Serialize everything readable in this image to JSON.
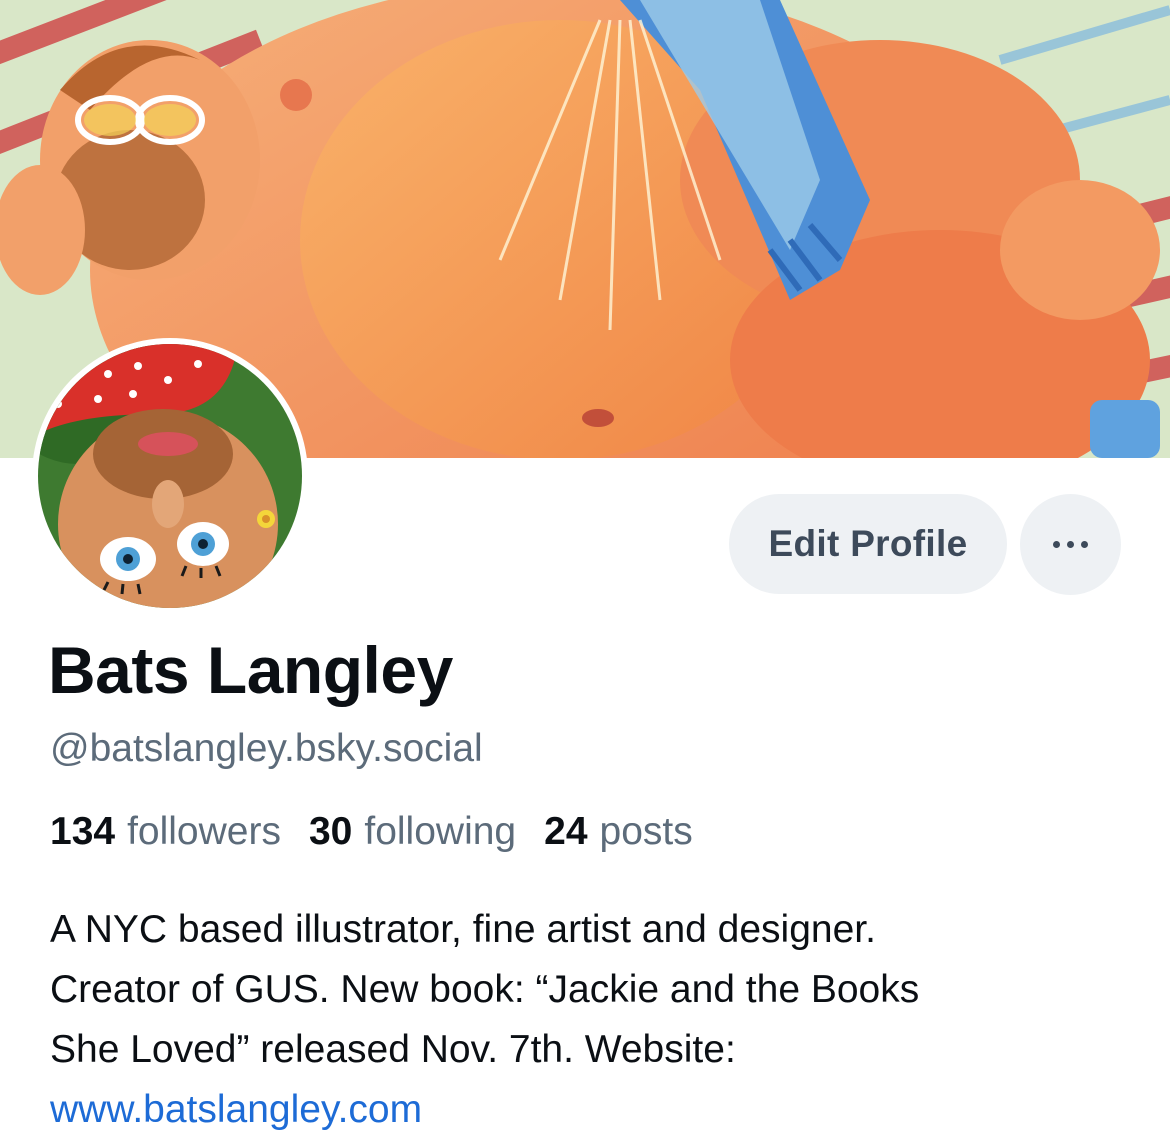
{
  "profile": {
    "banner_alt": "",
    "display_name": "Bats Langley",
    "handle": "@batslangley.bsky.social",
    "stats": {
      "followers_count": "134",
      "followers_label": "followers",
      "following_count": "30",
      "following_label": "following",
      "posts_count": "24",
      "posts_label": "posts"
    },
    "bio_lines": [
      "A NYC based illustrator, fine artist and designer.",
      "Creator of GUS. New book: “Jackie and the Books",
      "She Loved” released Nov. 7th. Website:"
    ],
    "bio_link": "www.batslangley.com"
  },
  "actions": {
    "edit_profile_label": "Edit Profile",
    "more_icon": "ellipsis-horizontal-icon"
  },
  "colors": {
    "link": "#1d6bd6",
    "button_bg": "#eef1f4",
    "secondary_text": "#5c6b7a",
    "primary_text": "#0b0f14"
  }
}
